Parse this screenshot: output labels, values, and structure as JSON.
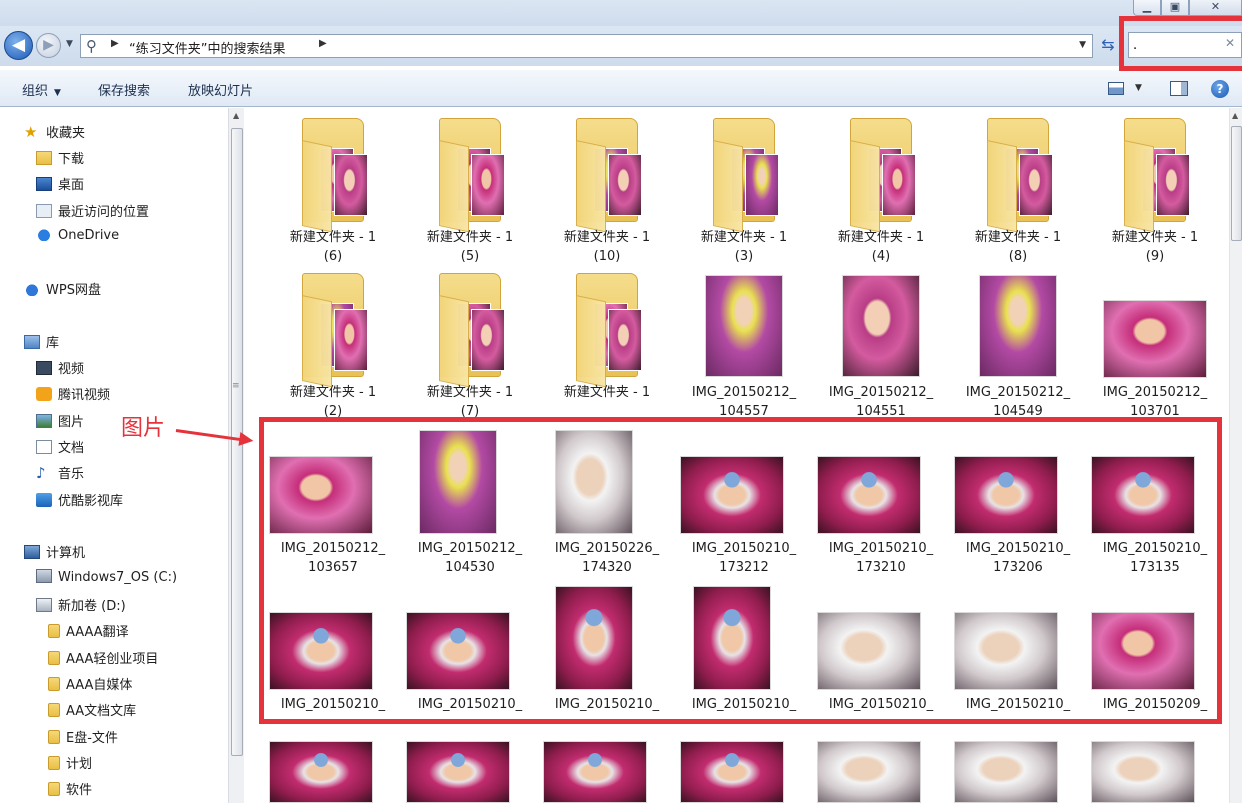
{
  "window": {
    "min": "▁",
    "max": "▣",
    "close": "✕"
  },
  "address": {
    "crumb": "“练习文件夹”中的搜索结果",
    "search_value": "."
  },
  "commands": {
    "organize": "组织",
    "save_search": "保存搜索",
    "slideshow": "放映幻灯片"
  },
  "nav": {
    "favorites": "收藏夹",
    "downloads": "下载",
    "desktop": "桌面",
    "recent": "最近访问的位置",
    "onedrive": "OneDrive",
    "wps": "WPS网盘",
    "libraries": "库",
    "videos": "视频",
    "tencent_video": "腾讯视频",
    "pictures": "图片",
    "documents": "文档",
    "music": "音乐",
    "youku": "优酷影视库",
    "computer": "计算机",
    "os_drive": "Windows7_OS (C:)",
    "new_volume": "新加卷 (D:)",
    "folders": [
      "AAAA翻译",
      "AAA轻创业项目",
      "AAA自媒体",
      "AA文档文库",
      "E盘-文件",
      "计划",
      "软件"
    ]
  },
  "row1": [
    {
      "line1": "新建文件夹 - 1",
      "line2": "(6)"
    },
    {
      "line1": "新建文件夹 - 1",
      "line2": "(5)"
    },
    {
      "line1": "新建文件夹 - 1",
      "line2": "(10)"
    },
    {
      "line1": "新建文件夹 - 1",
      "line2": "(3)"
    },
    {
      "line1": "新建文件夹 - 1",
      "line2": "(4)"
    },
    {
      "line1": "新建文件夹 - 1",
      "line2": "(8)"
    },
    {
      "line1": "新建文件夹 - 1",
      "line2": "(9)"
    }
  ],
  "row2": [
    {
      "line1": "新建文件夹 - 1",
      "line2": "(2)"
    },
    {
      "line1": "新建文件夹 - 1",
      "line2": "(7)"
    },
    {
      "line1": "新建文件夹 - 1",
      "line2": ""
    },
    {
      "line1": "IMG_20150212_",
      "line2": "104557"
    },
    {
      "line1": "IMG_20150212_",
      "line2": "104551"
    },
    {
      "line1": "IMG_20150212_",
      "line2": "104549"
    },
    {
      "line1": "IMG_20150212_",
      "line2": "103701"
    }
  ],
  "row3": [
    {
      "line1": "IMG_20150212_",
      "line2": "103657"
    },
    {
      "line1": "IMG_20150212_",
      "line2": "104530"
    },
    {
      "line1": "IMG_20150226_",
      "line2": "174320"
    },
    {
      "line1": "IMG_20150210_",
      "line2": "173212"
    },
    {
      "line1": "IMG_20150210_",
      "line2": "173210"
    },
    {
      "line1": "IMG_20150210_",
      "line2": "173206"
    },
    {
      "line1": "IMG_20150210_",
      "line2": "173135"
    }
  ],
  "row4": [
    {
      "line1": "IMG_20150210_"
    },
    {
      "line1": "IMG_20150210_"
    },
    {
      "line1": "IMG_20150210_"
    },
    {
      "line1": "IMG_20150210_"
    },
    {
      "line1": "IMG_20150210_"
    },
    {
      "line1": "IMG_20150210_"
    },
    {
      "line1": "IMG_20150209_"
    }
  ],
  "annotation": {
    "label": "图片"
  },
  "colors": {
    "annotation_red": "#e5333c",
    "folder_yellow": "#e9c155"
  }
}
